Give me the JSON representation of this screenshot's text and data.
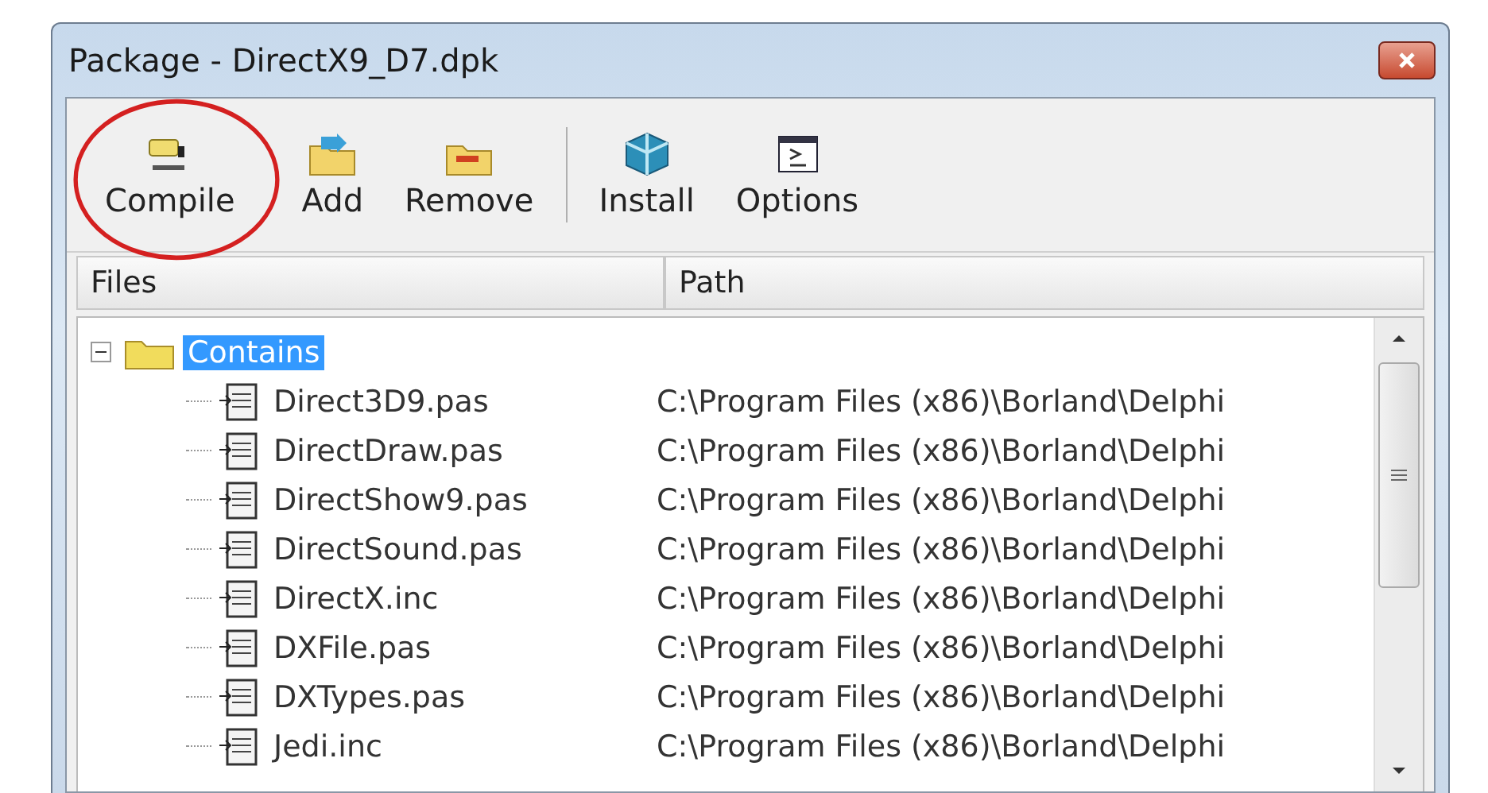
{
  "window": {
    "title": "Package - DirectX9_D7.dpk"
  },
  "toolbar": [
    {
      "label": "Compile",
      "kind": "compile",
      "circled": true
    },
    {
      "label": "Add",
      "kind": "add",
      "circled": false
    },
    {
      "label": "Remove",
      "kind": "remove",
      "circled": false
    },
    {
      "label": "Install",
      "kind": "install",
      "circled": false
    },
    {
      "label": "Options",
      "kind": "options",
      "circled": false
    }
  ],
  "columns": [
    "Files",
    "Path"
  ],
  "tree": [
    {
      "name": "Contains",
      "expanded": true,
      "selected": true,
      "children": [
        {
          "name": "Direct3D9.pas",
          "path": "C:\\Program Files (x86)\\Borland\\Delphi",
          "selected": false
        },
        {
          "name": "DirectDraw.pas",
          "path": "C:\\Program Files (x86)\\Borland\\Delphi",
          "selected": false
        },
        {
          "name": "DirectShow9.pas",
          "path": "C:\\Program Files (x86)\\Borland\\Delphi",
          "selected": false
        },
        {
          "name": "DirectSound.pas",
          "path": "C:\\Program Files (x86)\\Borland\\Delphi",
          "selected": false
        },
        {
          "name": "DirectX.inc",
          "path": "C:\\Program Files (x86)\\Borland\\Delphi",
          "selected": false
        },
        {
          "name": "DXFile.pas",
          "path": "C:\\Program Files (x86)\\Borland\\Delphi",
          "selected": false
        },
        {
          "name": "DXTypes.pas",
          "path": "C:\\Program Files (x86)\\Borland\\Delphi",
          "selected": false
        },
        {
          "name": "Jedi.inc",
          "path": "C:\\Program Files (x86)\\Borland\\Delphi",
          "selected": false
        }
      ]
    }
  ]
}
